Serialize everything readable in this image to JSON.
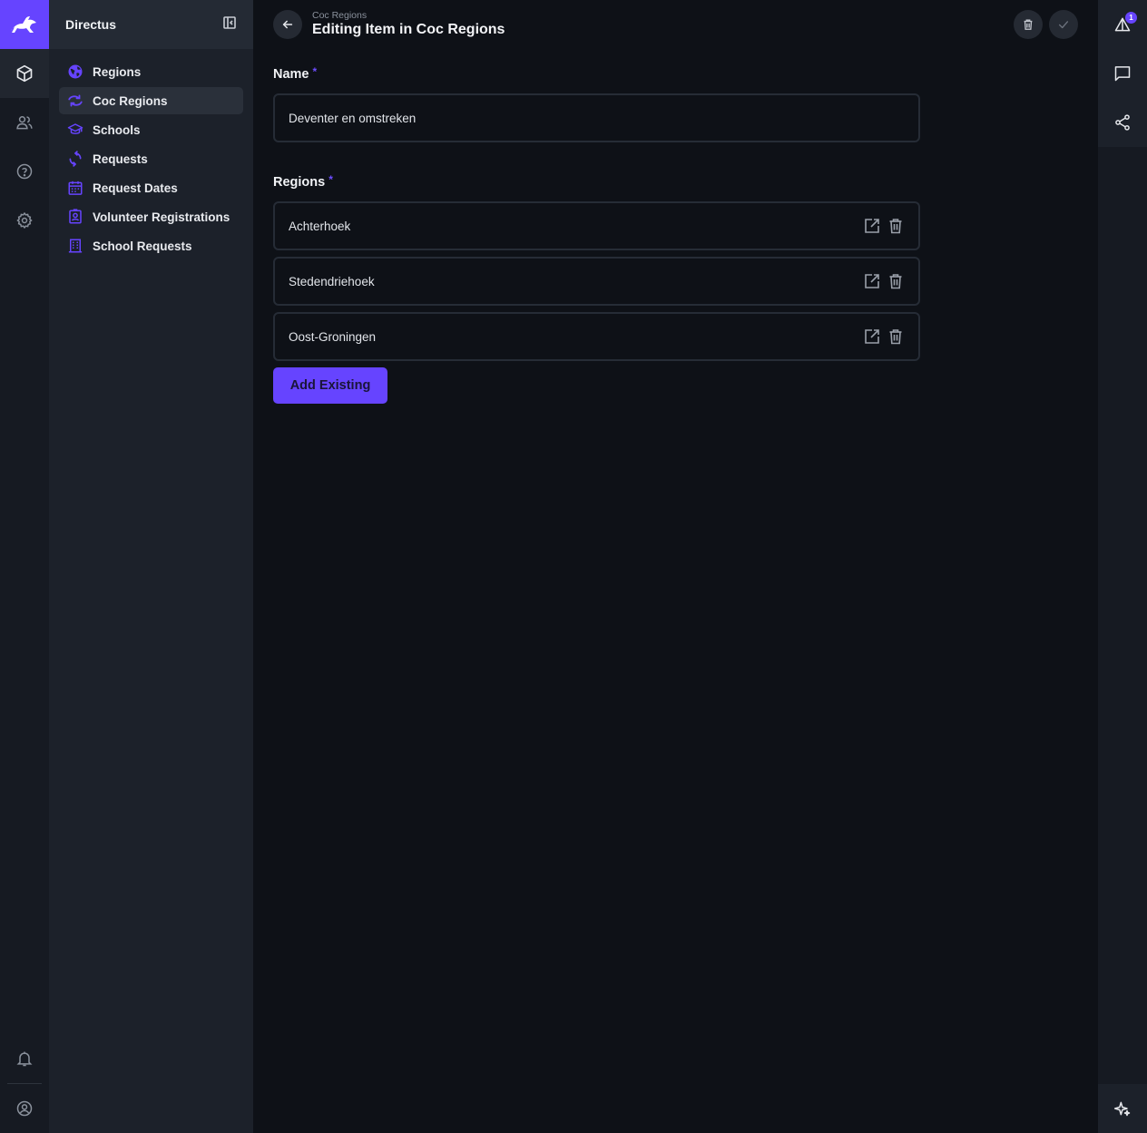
{
  "app": {
    "name": "Directus"
  },
  "colors": {
    "accent": "#6644ff",
    "background": "#0e1117",
    "sidebar": "#1c212a",
    "module_bar": "#161a22"
  },
  "module_bar": {
    "items": [
      {
        "icon": "box-icon",
        "active": true
      },
      {
        "icon": "users-icon",
        "active": false
      },
      {
        "icon": "help-icon",
        "active": false
      },
      {
        "icon": "gear-icon",
        "active": false
      }
    ],
    "bottom": [
      {
        "icon": "bell-icon"
      },
      {
        "icon": "account-icon"
      }
    ]
  },
  "nav": {
    "title": "Directus",
    "items": [
      {
        "label": "Regions",
        "icon": "globe-icon",
        "active": false
      },
      {
        "label": "Coc Regions",
        "icon": "sync-icon",
        "active": true
      },
      {
        "label": "Schools",
        "icon": "school-icon",
        "active": false
      },
      {
        "label": "Requests",
        "icon": "refresh-icon",
        "active": false
      },
      {
        "label": "Request Dates",
        "icon": "calendar-icon",
        "active": false
      },
      {
        "label": "Volunteer Registrations",
        "icon": "contact-card-icon",
        "active": false
      },
      {
        "label": "School Requests",
        "icon": "building-icon",
        "active": false
      }
    ]
  },
  "header": {
    "breadcrumb": "Coc Regions",
    "title": "Editing Item in Coc Regions"
  },
  "form": {
    "name_field": {
      "label": "Name",
      "required_mark": "*",
      "value": "Deventer en omstreken"
    },
    "regions_field": {
      "label": "Regions",
      "required_mark": "*",
      "items": [
        "Achterhoek",
        "Stedendriehoek",
        "Oost-Groningen"
      ],
      "add_label": "Add Existing"
    }
  },
  "right_sidebar": {
    "items": [
      {
        "icon": "revisions-icon",
        "badge": "1"
      },
      {
        "icon": "comments-icon"
      },
      {
        "icon": "share-icon"
      }
    ],
    "bottom": {
      "icon": "sparkle-icon"
    }
  }
}
